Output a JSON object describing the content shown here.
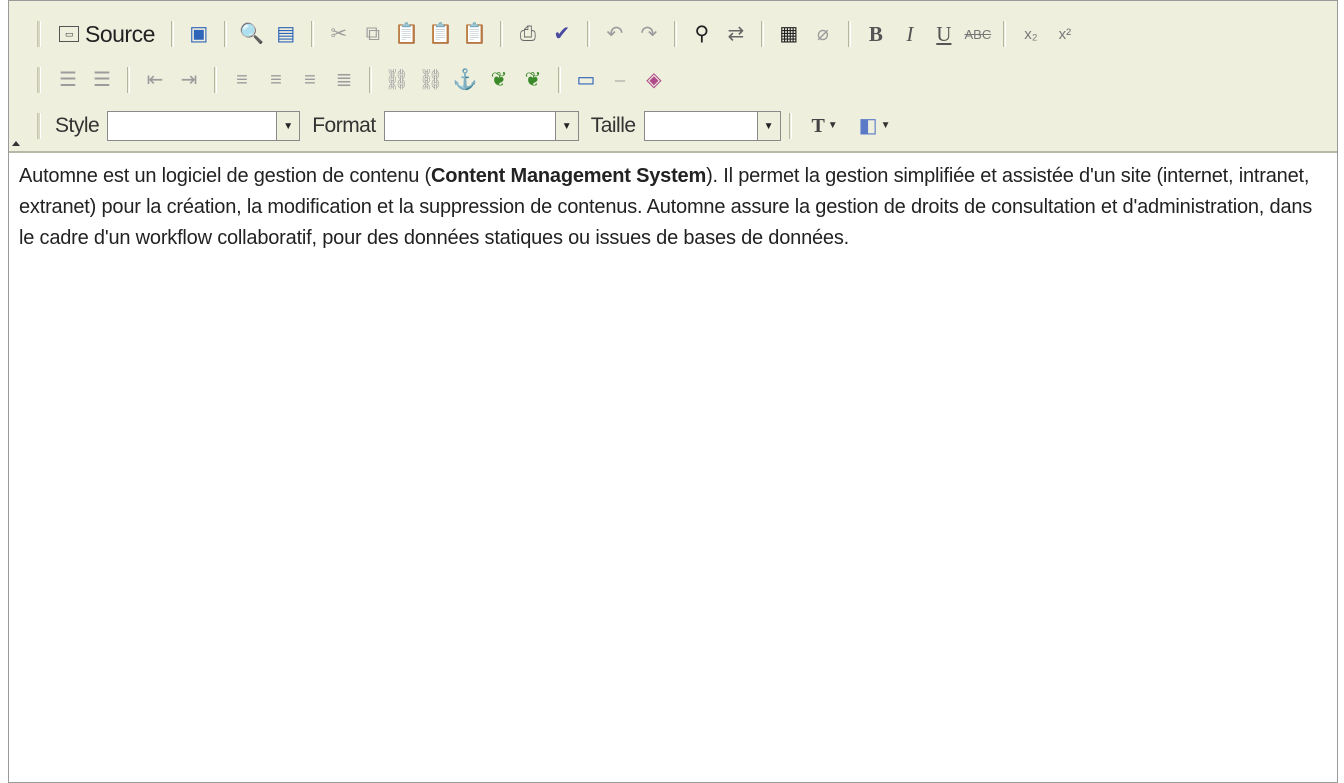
{
  "toolbar": {
    "source_label": "Source",
    "style_label": "Style",
    "style_value": "",
    "format_label": "Format",
    "format_value": "",
    "size_label": "Taille",
    "size_value": ""
  },
  "icons": {
    "row1": [
      "source-icon",
      "preview-icon",
      "print-preview-icon",
      "templates-icon",
      "cut-icon",
      "copy-icon",
      "paste-icon",
      "paste-text-icon",
      "paste-word-icon",
      "print-icon",
      "spellcheck-icon",
      "undo-icon",
      "redo-icon",
      "find-icon",
      "replace-icon",
      "select-all-icon",
      "remove-format-icon",
      "bold-icon",
      "italic-icon",
      "underline-icon",
      "strikethrough-icon",
      "subscript-icon",
      "superscript-icon"
    ],
    "row2": [
      "numbered-list-icon",
      "bulleted-list-icon",
      "outdent-icon",
      "indent-icon",
      "align-left-icon",
      "align-center-icon",
      "align-right-icon",
      "justify-icon",
      "link-icon",
      "unlink-icon",
      "anchor-icon",
      "image-icon",
      "flash-icon",
      "table-icon",
      "horizontal-rule-icon",
      "special-object-icon"
    ],
    "row3": [
      "text-color-icon",
      "background-color-icon"
    ]
  },
  "format_buttons": {
    "bold": "B",
    "italic": "I",
    "underline": "U",
    "strike": "ABC",
    "sub": "x₂",
    "sup": "x²"
  },
  "content": {
    "part1": "Automne est un logiciel de gestion de contenu (",
    "bold": "Content Management System",
    "part2": "). Il permet la gestion simplifiée et assistée d'un site (internet, intranet, extranet) pour la création, la modification et la suppression de contenus. Automne assure la gestion de droits de consultation et d'administration, dans le cadre d'un workflow collaboratif, pour des données statiques ou issues de bases de données."
  },
  "colors": {
    "toolbar_bg": "#efefde",
    "border": "#9a9a9a",
    "text": "#222222"
  }
}
